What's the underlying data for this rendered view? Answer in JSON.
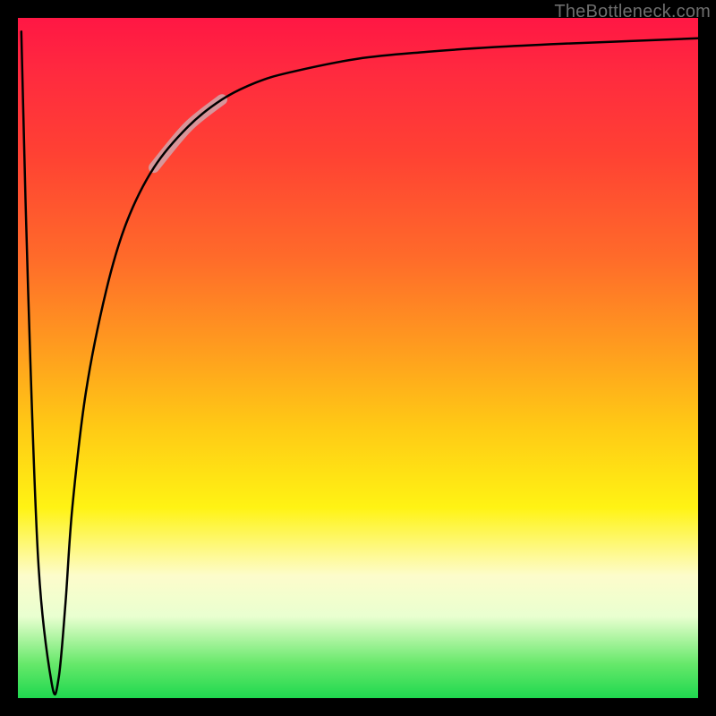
{
  "attribution": "TheBottleneck.com",
  "colors": {
    "frame": "#000000",
    "gradient_top": "#ff1744",
    "gradient_mid": "#ffd014",
    "gradient_bottom": "#1fd84f",
    "curve": "#000000",
    "highlight": "#d3a0a5"
  },
  "chart_data": {
    "type": "line",
    "title": "",
    "xlabel": "",
    "ylabel": "",
    "xlim": [
      0,
      100
    ],
    "ylim": [
      0,
      100
    ],
    "grid": false,
    "annotations": [
      {
        "text": "TheBottleneck.com",
        "position": "top-right"
      }
    ],
    "series": [
      {
        "name": "bottleneck-curve",
        "x": [
          0.5,
          1.5,
          3,
          5,
          6,
          7,
          8,
          10,
          13,
          16,
          20,
          25,
          30,
          35,
          40,
          50,
          60,
          70,
          80,
          90,
          100
        ],
        "y": [
          98,
          60,
          20,
          2,
          3,
          14,
          28,
          45,
          60,
          70,
          78,
          84,
          88,
          90.5,
          92,
          94,
          95,
          95.7,
          96.2,
          96.6,
          97
        ]
      }
    ],
    "highlight_segment": {
      "series": "bottleneck-curve",
      "x_start": 20,
      "x_end": 30,
      "note": "thick translucent pink overlay on the rising part of the curve"
    },
    "legend": false
  }
}
